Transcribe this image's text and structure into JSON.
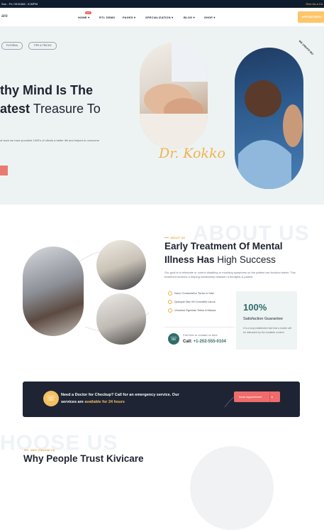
{
  "topbar": {
    "hours": "Sun - Fri: 09:00AM - 5:30PM",
    "right_text": "Give Us a Ca"
  },
  "nav": {
    "logo": "are",
    "items": [
      "HOME ▾",
      "RTL DEMO",
      "PAGES ▾",
      "SPECIALIZATION ▾",
      "BLOG ▾",
      "SHOP ▾"
    ],
    "home_badge": "HOT",
    "cta": "APPOINTMENT"
  },
  "hero": {
    "tags": [
      "TUTORIAL",
      "TIPS & TRICKS"
    ],
    "headline_1": "thy Mind Is The",
    "headline_2_bold": "atest",
    "headline_2_rest": " Treasure To",
    "subtitle": "of work we have provided 1000's of clients a better life and helped to overcome",
    "signature": "Dr. Kokko",
    "ring_text": "WE CREATE MO"
  },
  "about": {
    "watermark": "ABOUT US",
    "tag": "ABOUT US",
    "title_line1": "Early Treatment Of Mental",
    "title_line2_bold": "Illness Has",
    "title_line2_rest": " High Success",
    "paragraph": "Our goal is to eliminate or control disabling or troubling symptoms so the patient can function better. This treatment involves a helping relationship between a therapist & patient.",
    "checks": [
      "Nunc Consectetur Tortor In Nisi",
      "Quisque Nec Mi Convallis Lacus",
      "Vivamus Egestas Tellus A Massa"
    ],
    "phone_label": "Feel free to contact us here",
    "phone_call": "Call:",
    "phone_number": " +1-202-555-0104",
    "stat_value": "100%",
    "stat_label": "Satisfaction Guarantee",
    "stat_text": "It is a long established fact that a reader will be distracted by the readable content"
  },
  "banner": {
    "line1": "Need a Doctor for Checkup? Call for an emergency service. Our",
    "line2_prefix": "services are ",
    "line2_highlight": "available for 24 hours",
    "button": "Book Appointment",
    "button_arrow": "▸"
  },
  "why": {
    "watermark": "HOOSE US",
    "tag": "WHY CHOOSE US",
    "title": "Why People Trust Kivicare"
  },
  "colors": {
    "teal": "#2f6b69",
    "accent_orange": "#f0ab45",
    "coral": "#f06b6b",
    "dark": "#1e2433"
  }
}
